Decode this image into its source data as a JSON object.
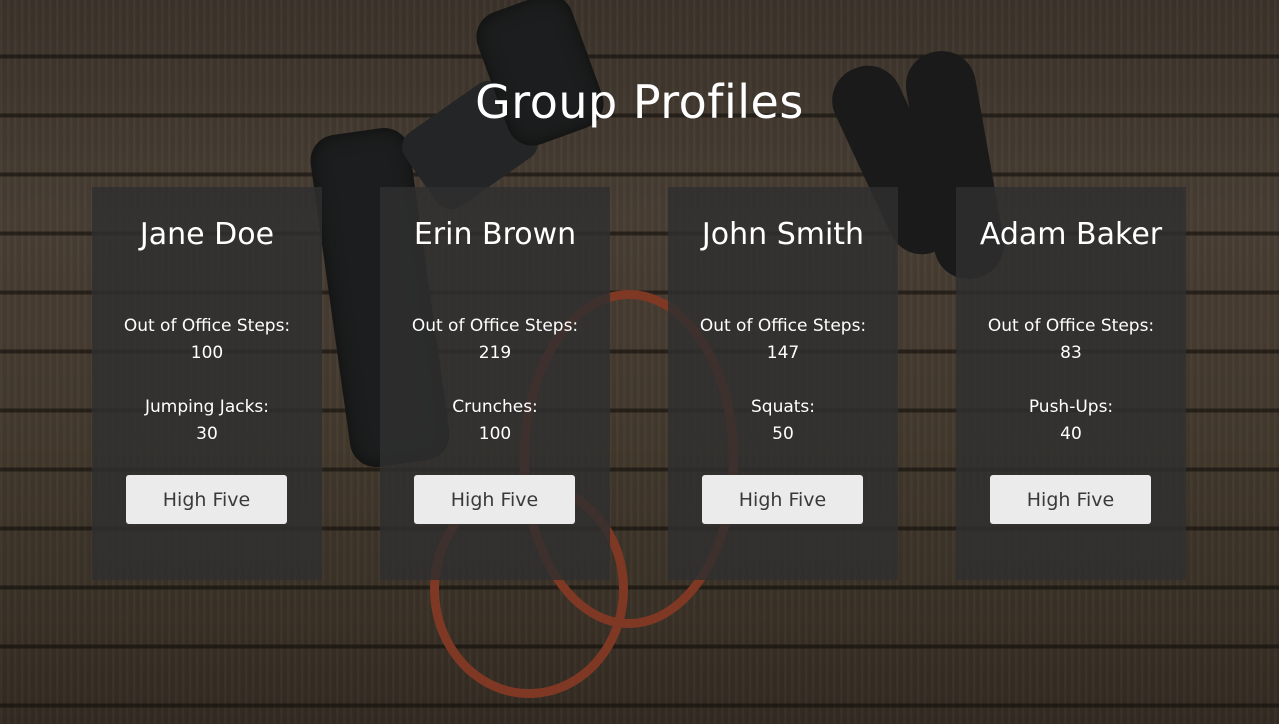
{
  "page": {
    "title": "Group Profiles"
  },
  "profiles": [
    {
      "name": "Jane Doe",
      "stat1_label": "Out of Office Steps:",
      "stat1_value": "100",
      "stat2_label": "Jumping Jacks:",
      "stat2_value": "30",
      "button_label": "High Five"
    },
    {
      "name": "Erin Brown",
      "stat1_label": "Out of Office Steps:",
      "stat1_value": "219",
      "stat2_label": "Crunches:",
      "stat2_value": "100",
      "button_label": "High Five"
    },
    {
      "name": "John Smith",
      "stat1_label": "Out of Office Steps:",
      "stat1_value": "147",
      "stat2_label": "Squats:",
      "stat2_value": "50",
      "button_label": "High Five"
    },
    {
      "name": "Adam Baker",
      "stat1_label": "Out of Office Steps:",
      "stat1_value": "83",
      "stat2_label": "Push-Ups:",
      "stat2_value": "40",
      "button_label": "High Five"
    }
  ],
  "colors": {
    "card_background": "#303030",
    "button_background": "#ebebeb",
    "button_text": "#3a3a3a",
    "text": "#ffffff"
  }
}
